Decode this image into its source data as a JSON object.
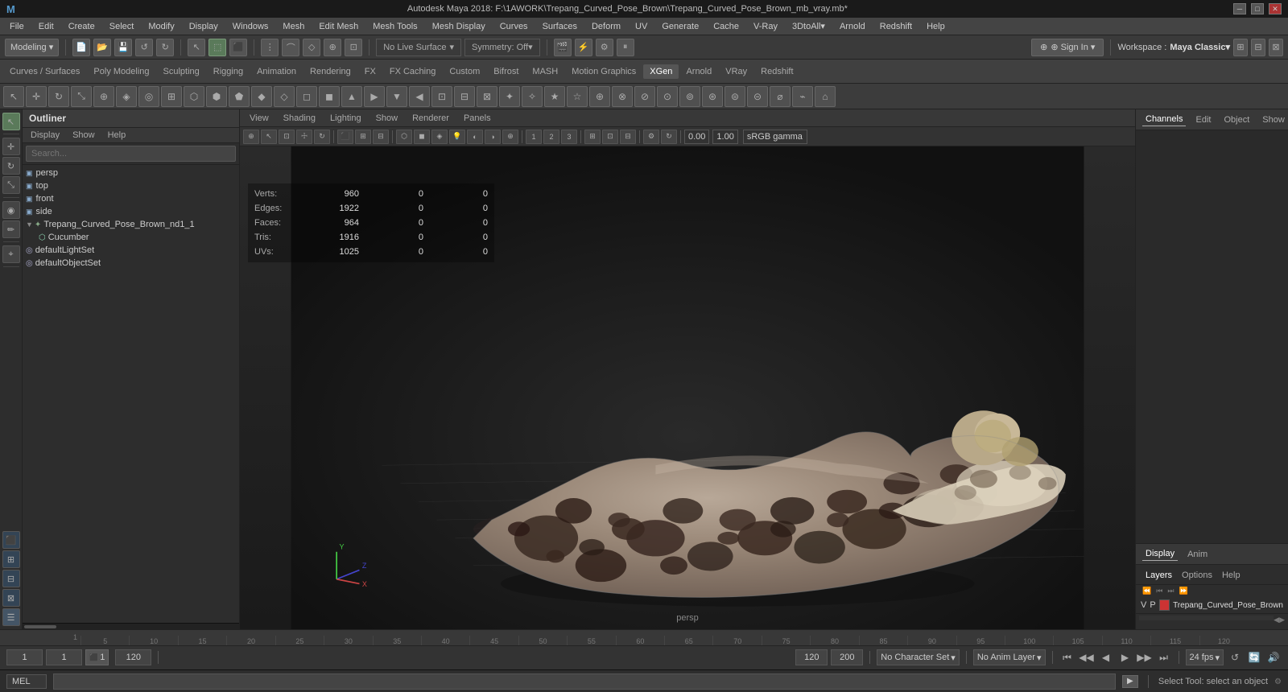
{
  "titleBar": {
    "title": "Autodesk Maya 2018: F:\\1AWORK\\Trepang_Curved_Pose_Brown\\Trepang_Curved_Pose_Brown_mb_vray.mb*",
    "minBtn": "─",
    "maxBtn": "□",
    "closeBtn": "✕"
  },
  "menuBar": {
    "items": [
      "File",
      "Edit",
      "Create",
      "Select",
      "Modify",
      "Display",
      "Windows",
      "Mesh",
      "Edit Mesh",
      "Mesh Tools",
      "Mesh Display",
      "Curves",
      "Surfaces",
      "Deform",
      "UV",
      "Generate",
      "Cache",
      "V-Ray",
      "3DtoAll▾",
      "Arnold",
      "Redshift",
      "Help"
    ]
  },
  "workspaceBar": {
    "workspaceLabel": "Workspace :",
    "workspaceValue": "Maya Classic▾",
    "modeling": "Modeling ▾",
    "snapLiveSurface": "No Live Surface",
    "symmetry": "Symmetry: Off",
    "signIn": "⊕ Sign In ▾"
  },
  "shelfBar": {
    "tabs": [
      "Curves / Surfaces",
      "Poly Modeling",
      "Sculpting",
      "Rigging",
      "Animation",
      "Rendering",
      "FX",
      "FX Caching",
      "Custom",
      "Bifrost",
      "MASH",
      "Motion Graphics",
      "XGen",
      "Arnold",
      "VRay",
      "Redshift"
    ]
  },
  "outliner": {
    "title": "Outliner",
    "menuItems": [
      "Display",
      "Show",
      "Help"
    ],
    "searchPlaceholder": "Search...",
    "items": [
      {
        "label": "persp",
        "type": "camera",
        "indent": 0
      },
      {
        "label": "top",
        "type": "camera",
        "indent": 0
      },
      {
        "label": "front",
        "type": "camera",
        "indent": 0
      },
      {
        "label": "side",
        "type": "camera",
        "indent": 0
      },
      {
        "label": "Trepang_Curved_Pose_Brown_nd1_1",
        "type": "group",
        "indent": 0
      },
      {
        "label": "Cucumber",
        "type": "mesh",
        "indent": 1
      },
      {
        "label": "defaultLightSet",
        "type": "set",
        "indent": 0
      },
      {
        "label": "defaultObjectSet",
        "type": "set",
        "indent": 0
      }
    ]
  },
  "viewportMenu": {
    "items": [
      "View",
      "Shading",
      "Lighting",
      "Show",
      "Renderer",
      "Panels"
    ]
  },
  "meshStats": {
    "verts": {
      "label": "Verts:",
      "val1": "960",
      "val2": "0",
      "val3": "0"
    },
    "edges": {
      "label": "Edges:",
      "val1": "1922",
      "val2": "0",
      "val3": "0"
    },
    "faces": {
      "label": "Faces:",
      "val1": "964",
      "val2": "0",
      "val3": "0"
    },
    "tris": {
      "label": "Tris:",
      "val1": "1916",
      "val2": "0",
      "val3": "0"
    },
    "uvs": {
      "label": "UVs:",
      "val1": "1025",
      "val2": "0",
      "val3": "0"
    }
  },
  "viewport": {
    "label": "persp",
    "gammaValue": "0.00",
    "gammaValue2": "1.00",
    "colorSpace": "sRGB gamma"
  },
  "rightPanel": {
    "tabs": [
      "Channels",
      "Edit",
      "Object",
      "Show"
    ],
    "activeTab": "Channels",
    "bottomTabs": [
      "Display",
      "Anim"
    ],
    "layerTabs": [
      "Layers",
      "Options",
      "Help"
    ],
    "layerLabel": "Trepang_Curved_Pose_Brown",
    "vpLabel": "V",
    "pLabel": "P"
  },
  "timeline": {
    "startFrame": "1",
    "endFrame": "120",
    "currentFrame": "1",
    "rangeStart": "1",
    "rangeEnd": "120",
    "playbackEnd": "200",
    "fps": "24 fps",
    "noCharacter": "No Character Set",
    "noAnim": "No Anim Layer",
    "ticks": [
      "",
      "5",
      "",
      "",
      "",
      "10",
      "",
      "",
      "",
      "15",
      "",
      "",
      "",
      "20",
      "",
      "",
      "",
      "25",
      "",
      "",
      "",
      "30",
      "",
      "",
      "",
      "35",
      "",
      "",
      "",
      "40",
      "",
      "",
      "",
      "45",
      "",
      "",
      "",
      "50",
      "",
      "",
      "",
      "55",
      "",
      "",
      "",
      "60",
      "",
      "",
      "",
      "65",
      "",
      "",
      "",
      "70",
      "",
      "",
      "",
      "75",
      "",
      "",
      "",
      "80",
      "",
      "",
      "",
      "85",
      "",
      "",
      "",
      "90",
      "",
      "",
      "",
      "95",
      "",
      "",
      "",
      "100",
      "",
      "",
      "",
      "105",
      "",
      "",
      "",
      "110",
      "",
      "",
      "",
      "115",
      "",
      "",
      "",
      "120"
    ]
  },
  "statusBar": {
    "melLabel": "MEL",
    "melPlaceholder": "",
    "statusText": "Select Tool: select an object"
  }
}
